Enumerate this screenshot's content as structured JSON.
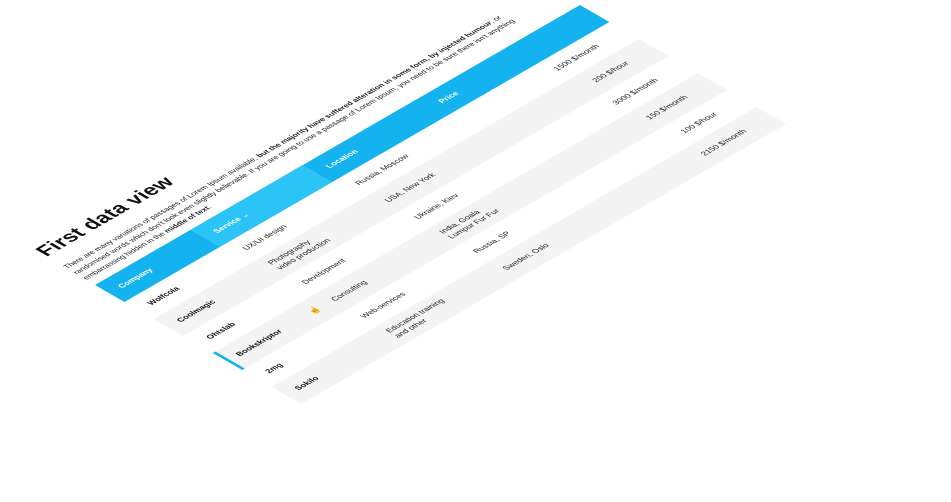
{
  "title": "First data view",
  "intro": {
    "part1": "There are many variations of passages of Lorem Ipsum available, ",
    "part2": "but the majority have suffered alteration in some form, by injected humour",
    "part3": ", or randomised words which don't look even slightly believable. If you are going to use a passage of Lorem Ipsum, you need to be sure there isn't anything embarrassing hidden in the ",
    "part4": "middle of text",
    "part5": "."
  },
  "table": {
    "headers": {
      "company": "Company",
      "service": "Service",
      "location": "Location",
      "price": "Price"
    },
    "sort_icon": "chevron-down-icon",
    "rows": [
      {
        "company": "Wolfcola",
        "service": "UX/UI design",
        "location": "Russia, Moscow",
        "price": "1500 $/month"
      },
      {
        "company": "Coolmagic",
        "service": "Photography\nvideo production",
        "location": "USA, New York",
        "price": "200 $/hour"
      },
      {
        "company": "Ohtslab",
        "service": "Development",
        "location": "Ukraine, Kiev",
        "price": "3000 $/month"
      },
      {
        "company": "Bookskriptor",
        "service": "Consulting",
        "location": "India, Goala\nLumpur Fur Fur",
        "price": "150 $/month",
        "pointer_icon": "hand-pointer-icon"
      },
      {
        "company": "2mg",
        "service": "Web-services",
        "location": "Russia, SP",
        "price": "100 $/hour"
      },
      {
        "company": "Sokilo",
        "service": "Education training\nand other",
        "location": "Sweden, Oslo",
        "price": "2150 $/month"
      }
    ]
  },
  "colors": {
    "accent": "#14b3f0",
    "accent_light": "#2cc4f6",
    "row_alt": "#f4f4f4",
    "text": "#222222"
  }
}
